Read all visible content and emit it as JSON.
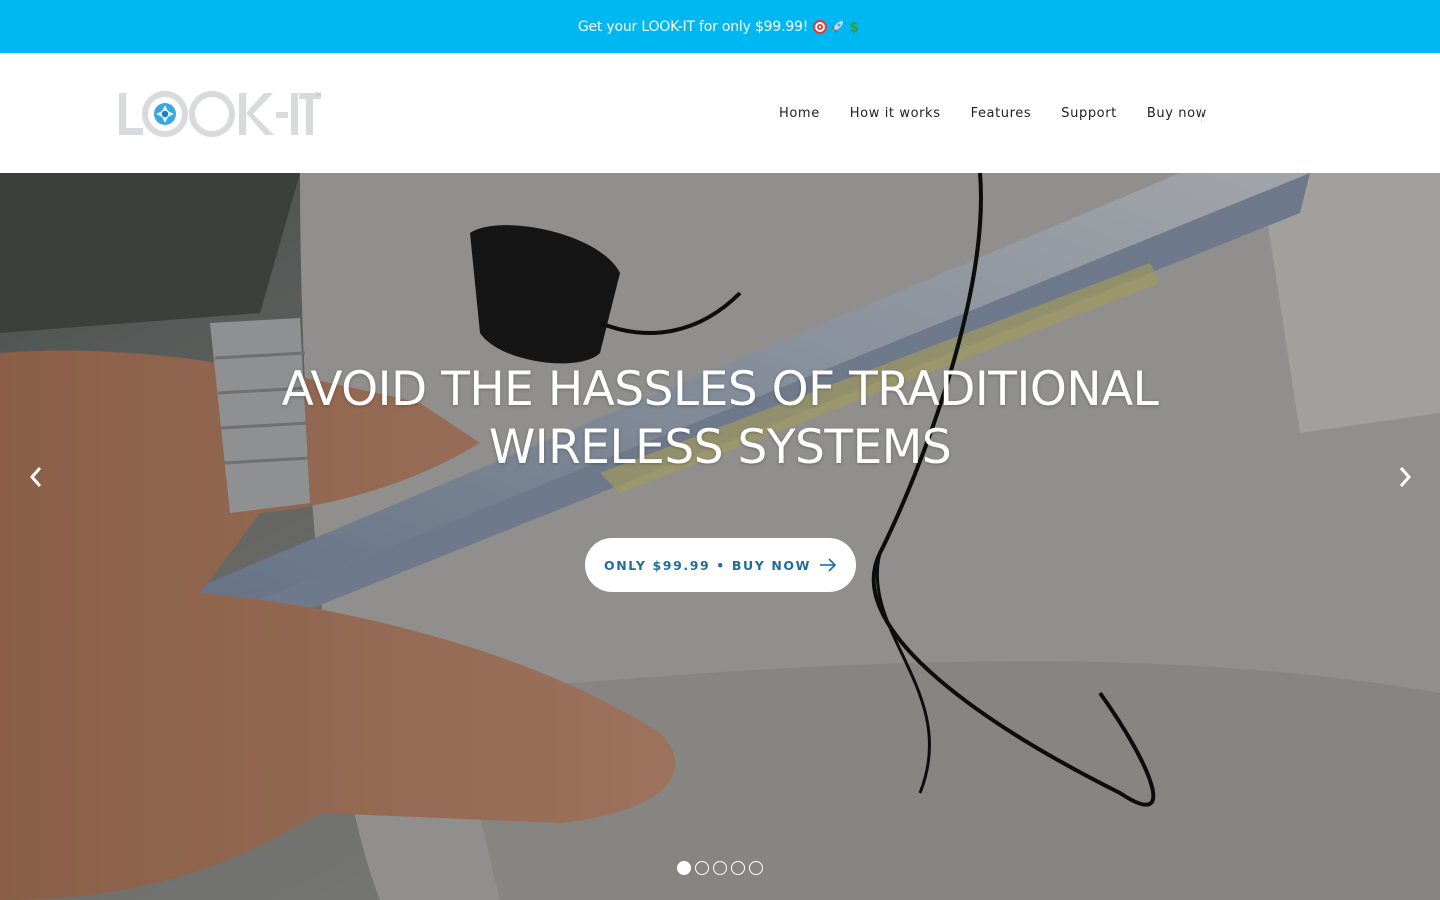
{
  "announcement": {
    "text": "Get your LOOK-IT for only $99.99!",
    "emoji_icons": [
      "target-icon",
      "rocket-icon",
      "dollar-icon"
    ],
    "bg_color": "#00b8f1"
  },
  "header": {
    "logo_text": "LOOK-IT",
    "nav": [
      {
        "label": "Home"
      },
      {
        "label": "How it works"
      },
      {
        "label": "Features"
      },
      {
        "label": "Support"
      },
      {
        "label": "Buy now"
      }
    ]
  },
  "hero": {
    "title_line1": "AVOID THE HASSLES OF TRADITIONAL",
    "title_line2": "WIRELESS SYSTEMS",
    "cta_label": "ONLY $99.99 • BUY NOW",
    "cta_color": "#1f6d9e",
    "prev_icon": "chevron-left-icon",
    "next_icon": "chevron-right-icon",
    "slides_total": 5,
    "active_slide": 1
  }
}
